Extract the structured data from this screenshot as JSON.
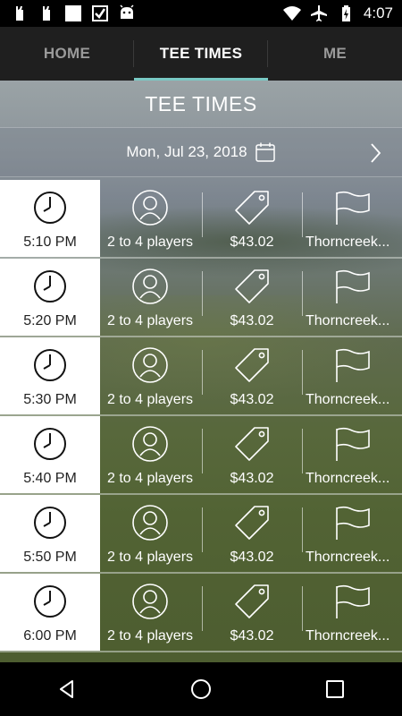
{
  "status_bar": {
    "time": "4:07",
    "left_icons": [
      "golf-bag-icon",
      "golf-bag-icon",
      "square-notification-icon",
      "check-app-icon",
      "android-icon"
    ],
    "right_icons": [
      "wifi-icon",
      "airplane-icon",
      "battery-charging-icon"
    ]
  },
  "tabs": [
    {
      "label": "HOME",
      "active": false
    },
    {
      "label": "TEE TIMES",
      "active": true
    },
    {
      "label": "ME",
      "active": false
    }
  ],
  "page": {
    "title": "TEE TIMES",
    "date": "Mon, Jul 23, 2018"
  },
  "tee_times": [
    {
      "time": "5:10 PM",
      "players": "2 to 4 players",
      "price": "$43.02",
      "course": "Thorncreek..."
    },
    {
      "time": "5:20 PM",
      "players": "2 to 4 players",
      "price": "$43.02",
      "course": "Thorncreek..."
    },
    {
      "time": "5:30 PM",
      "players": "2 to 4 players",
      "price": "$43.02",
      "course": "Thorncreek..."
    },
    {
      "time": "5:40 PM",
      "players": "2 to 4 players",
      "price": "$43.02",
      "course": "Thorncreek..."
    },
    {
      "time": "5:50 PM",
      "players": "2 to 4 players",
      "price": "$43.02",
      "course": "Thorncreek..."
    },
    {
      "time": "6:00 PM",
      "players": "2 to 4 players",
      "price": "$43.02",
      "course": "Thorncreek..."
    }
  ],
  "colors": {
    "accent": "#79c9c4",
    "tabbar": "#1f1f1f",
    "time_cell": "#ffffff"
  }
}
